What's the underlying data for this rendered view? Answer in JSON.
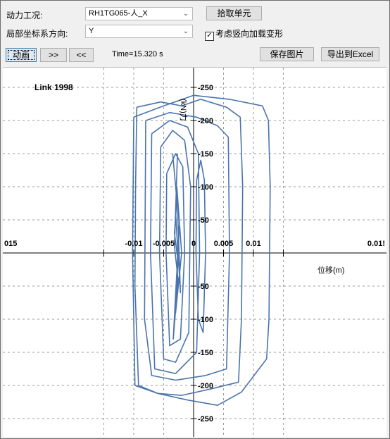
{
  "controls": {
    "case_label": "动力工况:",
    "case_value": "RH1TG065-人_X",
    "pick_button": "拾取单元",
    "dir_label": "局部坐标系方向:",
    "dir_value": "Y",
    "vertical_checkbox": "考虑竖向加载变形",
    "vertical_checked": true,
    "animate_button": "动画",
    "forward_button": ">>",
    "back_button": "<<",
    "time_text": "Time=15.320 s",
    "save_button": "保存图片",
    "export_button": "导出到Excel"
  },
  "chart_data": {
    "type": "line",
    "title": "Link 1998",
    "xlabel": "位移(m)",
    "ylabel": "(kN)力",
    "xlim": [
      -0.015,
      0.015
    ],
    "ylim": [
      -275,
      275
    ],
    "x_ticks": [
      "015",
      "-0.01",
      "-0.005",
      "0",
      "0.005",
      "0.01",
      "0.01!"
    ],
    "y_ticks": [
      "-250",
      "-200",
      "-150",
      "-100",
      "-50",
      "-50",
      "-100",
      "-150",
      "-200",
      "-250"
    ],
    "grid": true,
    "series_color": "#4a74ad",
    "series": [
      {
        "x": [
          -0.0095,
          -0.0055,
          -0.002,
          0.0012,
          0.0055,
          0.0078,
          0.0082,
          0.008,
          0.0075,
          0.003,
          -0.002,
          -0.006,
          -0.0092,
          -0.0098,
          -0.0097,
          -0.0095
        ],
        "y": [
          220,
          228,
          222,
          232,
          220,
          205,
          100,
          -100,
          -195,
          -205,
          -215,
          -212,
          -200,
          -50,
          100,
          220
        ]
      },
      {
        "x": [
          -0.01,
          -0.005,
          0.0,
          0.006,
          0.0115,
          0.0125,
          0.0128,
          0.0126,
          0.0122,
          0.008,
          0.004,
          -0.001,
          -0.006,
          -0.0098,
          -0.0102,
          -0.01
        ],
        "y": [
          205,
          222,
          238,
          232,
          222,
          200,
          100,
          -100,
          -160,
          -210,
          -230,
          -222,
          -212,
          -200,
          0,
          205
        ]
      },
      {
        "x": [
          -0.008,
          -0.004,
          0.0005,
          0.004,
          0.0058,
          0.006,
          0.0055,
          0.002,
          -0.003,
          -0.007,
          -0.0082,
          -0.008
        ],
        "y": [
          200,
          212,
          205,
          192,
          175,
          0,
          -175,
          -185,
          -192,
          -185,
          -100,
          200
        ]
      },
      {
        "x": [
          -0.007,
          -0.004,
          -0.001,
          0.0008,
          0.001,
          0.0005,
          -0.003,
          -0.0065,
          -0.0072,
          -0.007
        ],
        "y": [
          180,
          200,
          190,
          150,
          0,
          -150,
          -182,
          -175,
          0,
          180
        ]
      },
      {
        "x": [
          -0.0055,
          -0.0035,
          -0.0015,
          -0.0005,
          -0.0008,
          -0.003,
          -0.005,
          -0.0057,
          -0.0055
        ],
        "y": [
          160,
          185,
          170,
          100,
          -120,
          -165,
          -160,
          0,
          160
        ]
      },
      {
        "x": [
          -0.0045,
          -0.003,
          -0.0018,
          -0.0015,
          -0.0022,
          -0.004,
          -0.0046,
          -0.0045
        ],
        "y": [
          120,
          150,
          130,
          0,
          -130,
          -140,
          0,
          120
        ]
      },
      {
        "x": [
          0.0005,
          0.0012,
          0.0018,
          0.002,
          0.0016,
          0.0008,
          0.0004,
          0.0005
        ],
        "y": [
          110,
          140,
          110,
          0,
          -120,
          -100,
          0,
          110
        ]
      },
      {
        "x": [
          -0.0035,
          -0.0028,
          -0.0032,
          -0.0025,
          -0.003,
          -0.0022,
          -0.0028,
          -0.002,
          -0.003,
          -0.0024,
          -0.0034,
          -0.0026,
          -0.0032,
          -0.0027
        ],
        "y": [
          150,
          80,
          30,
          -20,
          60,
          -60,
          100,
          0,
          -90,
          40,
          -130,
          -40,
          10,
          150
        ]
      }
    ]
  }
}
